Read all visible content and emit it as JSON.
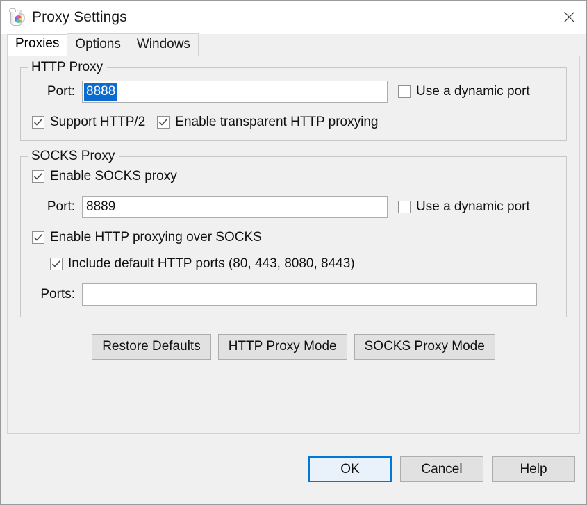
{
  "window": {
    "title": "Proxy Settings",
    "icon": "charles-jug-icon",
    "close_icon": "close-icon"
  },
  "tabs": [
    {
      "label": "Proxies",
      "active": true
    },
    {
      "label": "Options",
      "active": false
    },
    {
      "label": "Windows",
      "active": false
    }
  ],
  "http_proxy": {
    "group_title": "HTTP Proxy",
    "port_label": "Port:",
    "port_value": "8888",
    "port_selected": true,
    "dynamic_port": {
      "label": "Use a dynamic port",
      "checked": false
    },
    "support_http2": {
      "label": "Support HTTP/2",
      "checked": true
    },
    "transparent_proxying": {
      "label": "Enable transparent HTTP proxying",
      "checked": true
    }
  },
  "socks_proxy": {
    "group_title": "SOCKS Proxy",
    "enable_socks": {
      "label": "Enable SOCKS proxy",
      "checked": true
    },
    "port_label": "Port:",
    "port_value": "8889",
    "dynamic_port": {
      "label": "Use a dynamic port",
      "checked": false
    },
    "http_over_socks": {
      "label": "Enable HTTP proxying over SOCKS",
      "checked": true
    },
    "include_default_ports": {
      "label": "Include default HTTP ports (80, 443, 8080, 8443)",
      "checked": true
    },
    "ports_label": "Ports:",
    "ports_value": "",
    "ports_placeholder": ""
  },
  "mid_buttons": {
    "restore_defaults": "Restore Defaults",
    "http_proxy_mode": "HTTP Proxy Mode",
    "socks_proxy_mode": "SOCKS Proxy Mode"
  },
  "dialog_buttons": {
    "ok": "OK",
    "cancel": "Cancel",
    "help": "Help"
  },
  "colors": {
    "selection_blue": "#0a6cd0",
    "default_button_border": "#0078d7",
    "dialog_background": "#f0f0f0",
    "field_background": "#ffffff"
  }
}
